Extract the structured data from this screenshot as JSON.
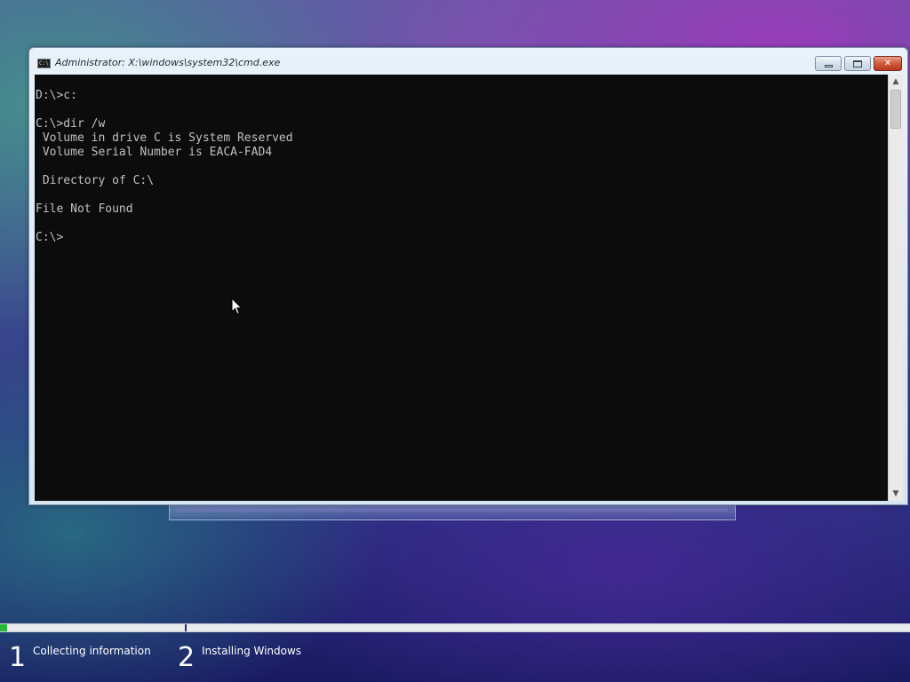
{
  "window": {
    "title": "Administrator: X:\\windows\\system32\\cmd.exe",
    "icon": "cmd-icon",
    "icon_text": "C:\\",
    "minimize_icon": "minimize-icon",
    "maximize_icon": "restore-icon",
    "close_icon": "close-icon",
    "close_glyph": "✕"
  },
  "console": {
    "lines": [
      "D:\\>c:",
      "",
      "C:\\>dir /w",
      " Volume in drive C is System Reserved",
      " Volume Serial Number is EACA-FAD4",
      "",
      " Directory of C:\\",
      "",
      "File Not Found",
      "",
      "C:\\>"
    ],
    "text_color": "#c0c0c0",
    "background_color": "#0c0c0c"
  },
  "scrollbar": {
    "up_arrow": "▲",
    "down_arrow": "▼"
  },
  "setup_progress": {
    "percent": 0.8,
    "fill_color": "#27b83a",
    "steps": [
      {
        "number": "1",
        "label": "Collecting information"
      },
      {
        "number": "2",
        "label": "Installing Windows"
      }
    ]
  }
}
